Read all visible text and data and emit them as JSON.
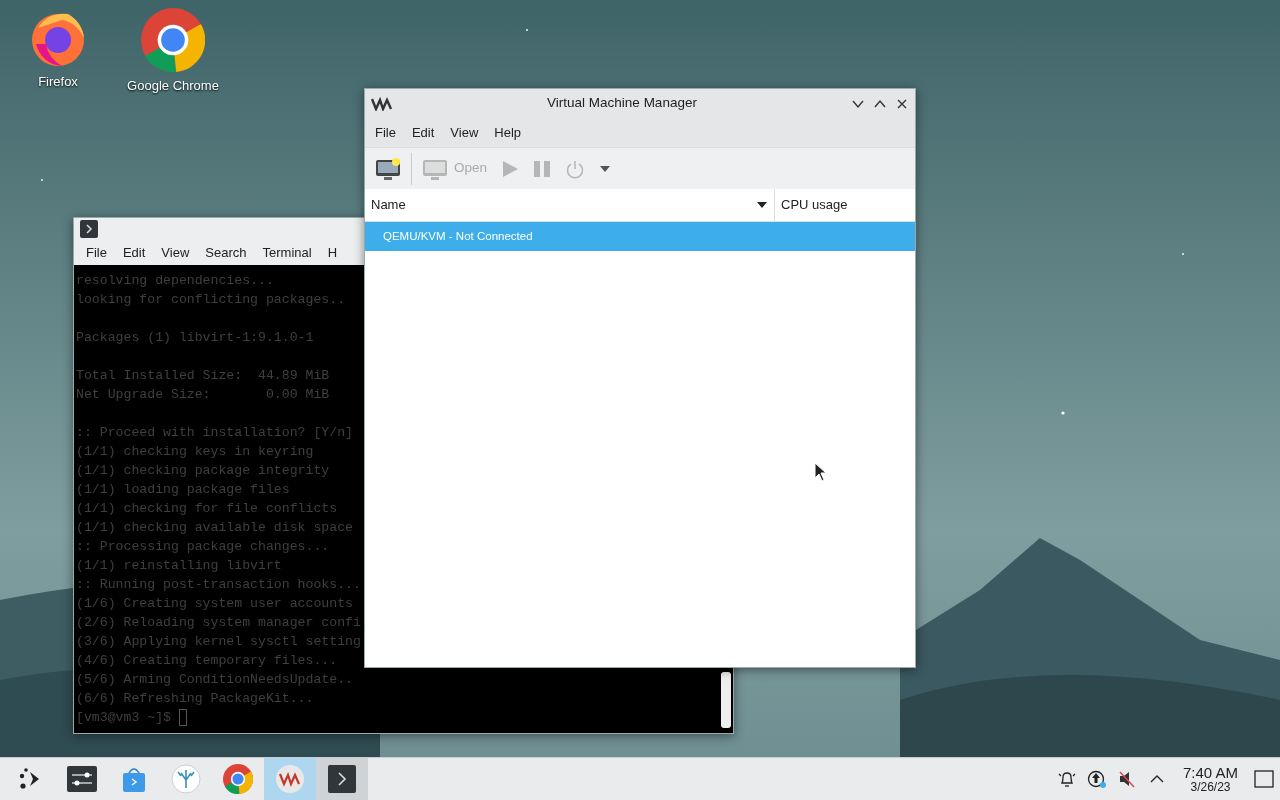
{
  "desktop_icons": [
    {
      "kind": "firefox",
      "label": "Firefox"
    },
    {
      "kind": "chrome",
      "label": "Google Chrome"
    }
  ],
  "terminal": {
    "menu": [
      "File",
      "Edit",
      "View",
      "Search",
      "Terminal",
      "H"
    ],
    "lines": [
      {
        "kind": "text",
        "text": "resolving dependencies..."
      },
      {
        "kind": "text",
        "text": "looking for conflicting packages.."
      },
      {
        "kind": "blank"
      },
      {
        "kind": "text",
        "text": "Packages (1) libvirt-1:9.1.0-1"
      },
      {
        "kind": "blank"
      },
      {
        "kind": "text",
        "text": "Total Installed Size:  44.89 MiB"
      },
      {
        "kind": "text",
        "text": "Net Upgrade Size:       0.00 MiB"
      },
      {
        "kind": "blank"
      },
      {
        "kind": "text",
        "text": ":: Proceed with installation? [Y/n]"
      },
      {
        "kind": "text",
        "text": "(1/1) checking keys in keyring"
      },
      {
        "kind": "text",
        "text": "(1/1) checking package integrity"
      },
      {
        "kind": "text",
        "text": "(1/1) loading package files"
      },
      {
        "kind": "text",
        "text": "(1/1) checking for file conflicts"
      },
      {
        "kind": "text",
        "text": "(1/1) checking available disk space"
      },
      {
        "kind": "text",
        "text": ":: Processing package changes..."
      },
      {
        "kind": "text",
        "text": "(1/1) reinstalling libvirt"
      },
      {
        "kind": "text",
        "text": ":: Running post-transaction hooks..."
      },
      {
        "kind": "text",
        "text": "(1/6) Creating system user accounts"
      },
      {
        "kind": "text",
        "text": "(2/6) Reloading system manager confi"
      },
      {
        "kind": "text",
        "text": "(3/6) Applying kernel sysctl setting"
      },
      {
        "kind": "text",
        "text": "(4/6) Creating temporary files..."
      },
      {
        "kind": "text",
        "text": "(5/6) Arming ConditionNeedsUpdate.."
      },
      {
        "kind": "text",
        "text": "(6/6) Refreshing PackageKit..."
      },
      {
        "kind": "prompt",
        "text": "[vm3@vm3 ~]$"
      }
    ]
  },
  "vmm": {
    "title": "Virtual Machine Manager",
    "menu": [
      "File",
      "Edit",
      "View",
      "Help"
    ],
    "toolbar": [
      {
        "kind": "new",
        "disabled": false
      },
      {
        "kind": "open",
        "label": "Open",
        "disabled": true
      },
      {
        "kind": "run",
        "disabled": true
      },
      {
        "kind": "pause",
        "disabled": true
      },
      {
        "kind": "power",
        "disabled": true
      },
      {
        "kind": "dropdown",
        "disabled": false
      }
    ],
    "columns": [
      "Name",
      "CPU usage"
    ],
    "rows": [
      {
        "name": "QEMU/KVM - Not Connected",
        "selected": true
      }
    ]
  },
  "taskbar": {
    "items": [
      {
        "kind": "launcher",
        "selected": false,
        "open": false
      },
      {
        "kind": "settings",
        "selected": false,
        "open": false
      },
      {
        "kind": "store",
        "selected": false,
        "open": false
      },
      {
        "kind": "coral",
        "selected": false,
        "open": false
      },
      {
        "kind": "chrome",
        "selected": false,
        "open": false
      },
      {
        "kind": "vmm",
        "selected": true,
        "open": true
      },
      {
        "kind": "terminal",
        "selected": false,
        "open": true
      }
    ],
    "tray": [
      {
        "kind": "bell"
      },
      {
        "kind": "update"
      },
      {
        "kind": "muted"
      },
      {
        "kind": "expand"
      }
    ],
    "time": "7:40 AM",
    "date": "3/26/23"
  }
}
